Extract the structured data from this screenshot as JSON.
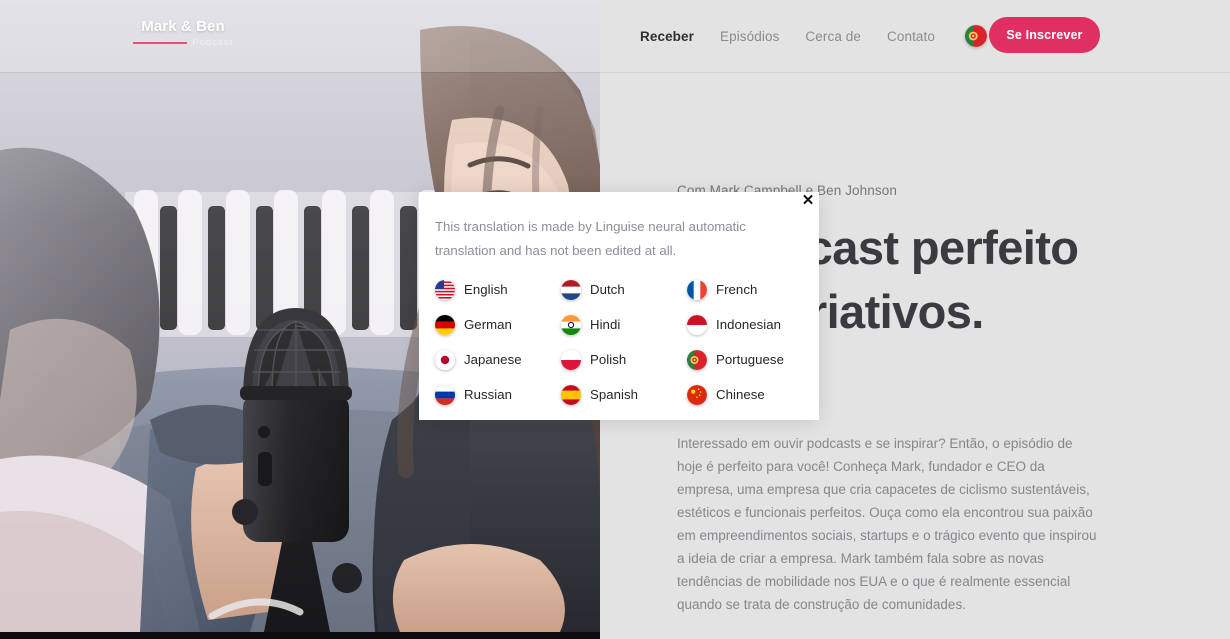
{
  "header": {
    "logo": {
      "name": "Mark & Ben",
      "subtitle": "Podcast"
    },
    "nav": [
      {
        "label": "Receber",
        "active": true
      },
      {
        "label": "Episódios",
        "active": false
      },
      {
        "label": "Cerca de",
        "active": false
      },
      {
        "label": "Contato",
        "active": false
      }
    ],
    "language_selector": {
      "icon": "portuguese-flag-icon",
      "current": "Portuguese"
    },
    "subscribe_label": "Se Inscrever"
  },
  "hero": {
    "eyebrow": "Com Mark Campbell e Ben Johnson",
    "headline": "O podcast perfeito para criativos.",
    "body": "Interessado em ouvir podcasts e se inspirar? Então, o episódio de hoje é perfeito para você! Conheça Mark, fundador e CEO da empresa, uma empresa que cria capacetes de ciclismo sustentáveis, estéticos e funcionais perfeitos. Ouça como ela encontrou sua paixão em empreendimentos sociais, startups e o trágico evento que inspirou a ideia de criar a empresa. Mark também fala sobre as novas tendências de mobilidade nos EUA e o que é realmente essencial quando se trata de construção de comunidades."
  },
  "translation_popup": {
    "note": "This translation is made by Linguise neural automatic translation and has not been edited at all.",
    "close_icon": "close-icon",
    "languages": [
      {
        "label": "English",
        "flag": "us-flag-icon"
      },
      {
        "label": "Dutch",
        "flag": "nl-flag-icon"
      },
      {
        "label": "French",
        "flag": "fr-flag-icon"
      },
      {
        "label": "German",
        "flag": "de-flag-icon"
      },
      {
        "label": "Hindi",
        "flag": "in-flag-icon"
      },
      {
        "label": "Indonesian",
        "flag": "id-flag-icon"
      },
      {
        "label": "Japanese",
        "flag": "jp-flag-icon"
      },
      {
        "label": "Polish",
        "flag": "pl-flag-icon"
      },
      {
        "label": "Portuguese",
        "flag": "pt-flag-icon"
      },
      {
        "label": "Russian",
        "flag": "ru-flag-icon"
      },
      {
        "label": "Spanish",
        "flag": "es-flag-icon"
      },
      {
        "label": "Chinese",
        "flag": "cn-flag-icon"
      }
    ]
  },
  "colors": {
    "accent": "#e03063",
    "background": "#e3e3e3",
    "heading": "#3a3a40",
    "body_text": "#86868e"
  }
}
